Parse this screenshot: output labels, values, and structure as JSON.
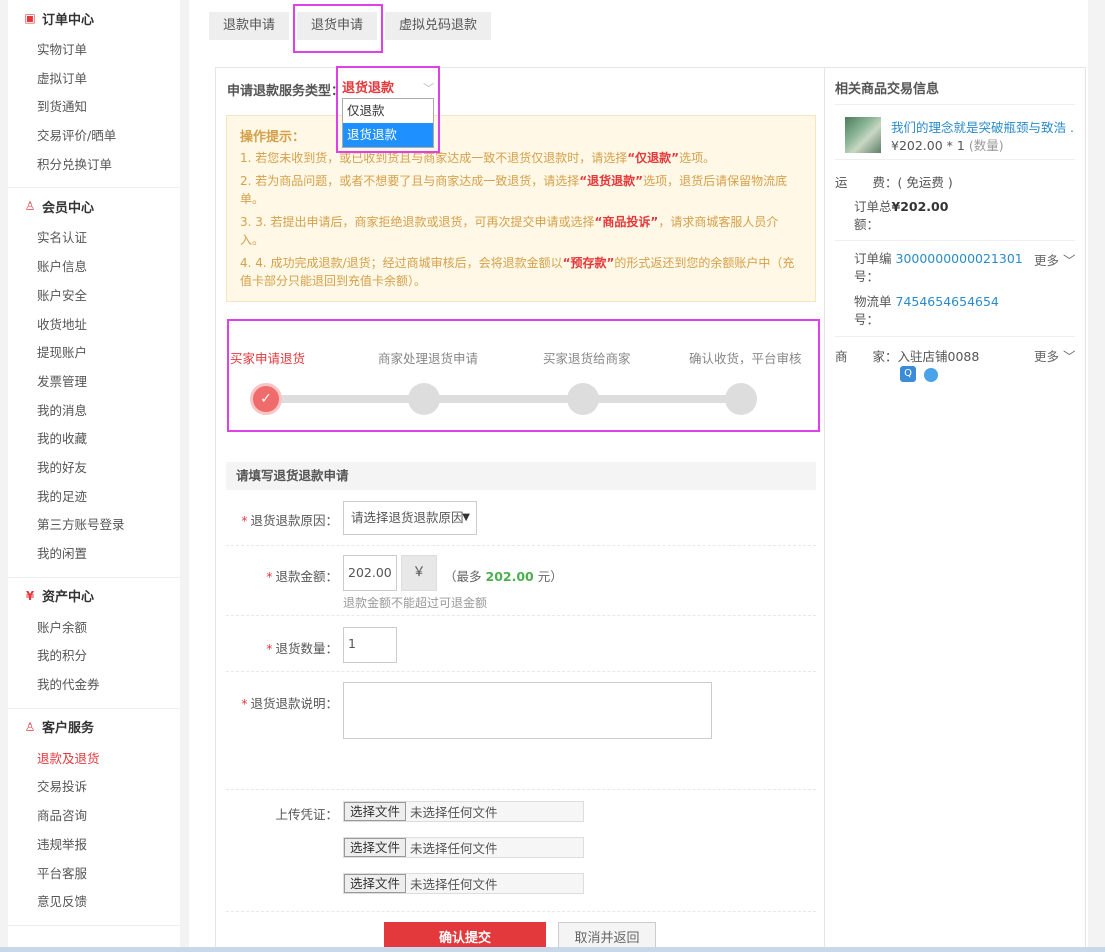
{
  "sidebar": {
    "sections": [
      {
        "title": "订单中心",
        "icon": "order-icon",
        "items": [
          "实物订单",
          "虚拟订单",
          "到货通知",
          "交易评价/晒单",
          "积分兑换订单"
        ]
      },
      {
        "title": "会员中心",
        "icon": "user-icon",
        "items": [
          "实名认证",
          "账户信息",
          "账户安全",
          "收货地址",
          "提现账户",
          "发票管理",
          "我的消息",
          "我的收藏",
          "我的好友",
          "我的足迹",
          "第三方账号登录",
          "我的闲置"
        ]
      },
      {
        "title": "资产中心",
        "icon": "yen-icon",
        "items": [
          "账户余额",
          "我的积分",
          "我的代金券"
        ]
      },
      {
        "title": "客户服务",
        "icon": "service-icon",
        "items": [
          "退款及退货",
          "交易投诉",
          "商品咨询",
          "违规举报",
          "平台客服",
          "意见反馈"
        ]
      }
    ]
  },
  "tabs": [
    "退款申请",
    "退货申请",
    "虚拟兑码退款"
  ],
  "service": {
    "label": "申请退款服务类型：",
    "selected": "退货退款",
    "options": [
      "仅退款",
      "退货退款"
    ]
  },
  "tips": {
    "title": "操作提示：",
    "items": [
      {
        "pre": "1. 若您未收到货，或已收到货且与商家达成一致不退货仅退款时，请选择",
        "em": "“仅退款”",
        "post": "选项。"
      },
      {
        "pre": "2. 若为商品问题，或者不想要了且与商家达成一致退货，请选择",
        "em": "“退货退款”",
        "post": "选项，退货后请保留物流底单。"
      },
      {
        "pre": "3. 3. 若提出申请后，商家拒绝退款或退货，可再次提交申请或选择",
        "em": "“商品投诉”",
        "post": "，请求商城客服人员介入。"
      },
      {
        "pre": "4. 4. 成功完成退款/退货；经过商城审核后，会将退款金额以",
        "em": "“预存款”",
        "post": "的形式返还到您的余额账户中（充值卡部分只能退回到充值卡余额）。"
      }
    ]
  },
  "steps": [
    "买家申请退货",
    "商家处理退货申请",
    "买家退货给商家",
    "确认收货，平台审核"
  ],
  "form": {
    "title": "请填写退货退款申请",
    "reason_label": "退货退款原因：",
    "reason_value": "请选择退货退款原因",
    "amount_label": "退款金额：",
    "amount_value": "202.00",
    "yen": "￥",
    "max_pre": "（最多",
    "max_value": "202.00",
    "max_post": "元）",
    "amount_hint": "退款金额不能超过可退金额",
    "qty_label": "退货数量：",
    "qty_value": "1",
    "desc_label": "退货退款说明：",
    "upload_label": "上传凭证：",
    "file_button": "选择文件",
    "file_status": "未选择任何文件",
    "required_mark": "*",
    "submit": "确认提交",
    "cancel": "取消并返回"
  },
  "side": {
    "title": "相关商品交易信息",
    "product_name": "我们的理念就是突破瓶颈与致浩 ...",
    "product_price": "¥202.00 * 1",
    "product_qty_note": "(数量)",
    "shipping_label": "运　　费：",
    "shipping_value": "( 免运费 )",
    "total_label_1": "订单总",
    "total_label_2": "额：",
    "total_value": "¥202.00",
    "order_label_1": "订单编",
    "order_label_2": "号：",
    "order_value": "3000000000021301",
    "more": "更多",
    "logistics_label_1": "物流单",
    "logistics_label_2": "号：",
    "logistics_value": "7454654654654",
    "merchant_label": "商　　家：",
    "merchant_value": "入驻店铺0088"
  }
}
